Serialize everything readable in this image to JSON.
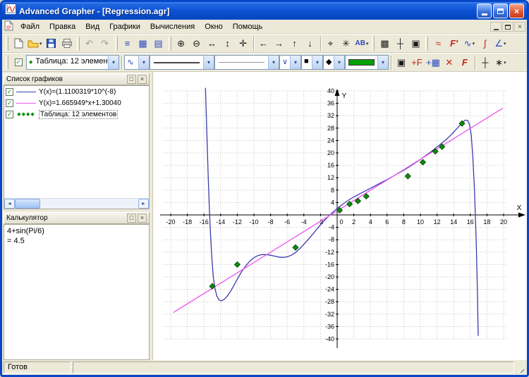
{
  "window": {
    "title": "Advanced Grapher - [Regression.agr]",
    "status_ready": "Готов"
  },
  "menu": {
    "items": [
      "Файл",
      "Правка",
      "Вид",
      "Графики",
      "Вычисления",
      "Окно",
      "Помощь"
    ]
  },
  "icons": {
    "dropdown": "▾",
    "undo": "↶",
    "redo": "↷",
    "graph_list": "≡",
    "data_table": "▦",
    "calculator": "▤",
    "zoom_in": "⊕",
    "zoom_out": "⊖",
    "zoom_x": "↔",
    "zoom_y": "↕",
    "move": "✛",
    "scroll_left": "←",
    "scroll_right": "→",
    "scroll_up": "↑",
    "scroll_down": "↓",
    "center": "⌖",
    "zoom_all": "✳",
    "labels": "AB",
    "grid": "▩",
    "axes": "┼",
    "graph_props": "▣",
    "regression": "≈",
    "derivative": "F′",
    "tangent": "∿",
    "integral": "∫",
    "angle": "∠",
    "visible_check": "✓",
    "curve_type": "∿",
    "hatch": "∨",
    "point_square": "■",
    "point_marker": "◆",
    "properties": "▣",
    "add_graph": "+F",
    "add_table": "+▦",
    "delete": "✕",
    "edit": "F",
    "options": "∗",
    "panel_box": "□",
    "panel_close": "×",
    "scrollbar_left": "◄",
    "scrollbar_right": "►"
  },
  "toolbar2": {
    "selected_object": "Таблица: 12 элементов"
  },
  "graph_list_panel": {
    "title": "Список графиков",
    "items": [
      {
        "checked": true,
        "label": "Y(x)=(1.1100319*10^(-8)",
        "color": "#3b3bb0",
        "sample": "line"
      },
      {
        "checked": true,
        "label": "Y(x)=1.665949*x+1.30040",
        "color": "#ee55ee",
        "sample": "line"
      },
      {
        "checked": true,
        "label": "Таблица: 12 элементов",
        "color": "#0a8f0a",
        "sample": "diamonds",
        "sample_glyphs": "◆◆◆◆",
        "selected": true
      }
    ]
  },
  "calculator_panel": {
    "title": "Калькулятор",
    "expression": "4+sin(Pi/6)",
    "result": "= 4.5"
  },
  "colors": {
    "titlebar_blue": "#0f54d7",
    "chrome_bg": "#ECE9D8",
    "grid_gray": "#c6c6c6",
    "curve_blue": "#3b3bb0",
    "line_magenta": "#ee55ee",
    "points_green": "#0a8f0a",
    "color_swatch_green": "#00a000"
  },
  "chart_data": {
    "type": "line",
    "title": "",
    "xlabel": "X",
    "ylabel": "Y",
    "xlim": [
      -21,
      21.5
    ],
    "ylim": [
      -42,
      42
    ],
    "x_ticks": [
      -20,
      -18,
      -16,
      -14,
      -12,
      -10,
      -8,
      -6,
      -4,
      -2,
      0,
      2,
      4,
      6,
      8,
      10,
      12,
      14,
      16,
      18,
      20
    ],
    "y_ticks": [
      -40,
      -36,
      -32,
      -28,
      -24,
      -20,
      -16,
      -12,
      -8,
      -4,
      4,
      8,
      12,
      16,
      20,
      24,
      28,
      32,
      36,
      40
    ],
    "grid": "dotted",
    "legend_position": "none",
    "series": [
      {
        "name": "Y(x)=(1.1100319*10^(-8)",
        "type": "line",
        "color": "#3b3bb0",
        "points": [
          [
            -15.82,
            41
          ],
          [
            -15.72,
            32
          ],
          [
            -15.62,
            23
          ],
          [
            -15.5,
            13
          ],
          [
            -15.38,
            4
          ],
          [
            -15.24,
            -5
          ],
          [
            -15.08,
            -13
          ],
          [
            -14.9,
            -19.5
          ],
          [
            -14.7,
            -23.5
          ],
          [
            -14.45,
            -26.2
          ],
          [
            -14.2,
            -27.4
          ],
          [
            -13.9,
            -27.7
          ],
          [
            -13.6,
            -27.3
          ],
          [
            -13.2,
            -26.2
          ],
          [
            -12.8,
            -24.6
          ],
          [
            -12.4,
            -22.7
          ],
          [
            -12,
            -20.7
          ],
          [
            -11.5,
            -18.4
          ],
          [
            -11,
            -16.5
          ],
          [
            -10.5,
            -14.9
          ],
          [
            -10,
            -13.8
          ],
          [
            -9.5,
            -13.1
          ],
          [
            -9,
            -12.8
          ],
          [
            -8.5,
            -12.8
          ],
          [
            -8,
            -13
          ],
          [
            -7.5,
            -13.3
          ],
          [
            -7,
            -13.6
          ],
          [
            -6.5,
            -13.7
          ],
          [
            -6,
            -13.5
          ],
          [
            -5.5,
            -13
          ],
          [
            -5,
            -12.1
          ],
          [
            -4.5,
            -10.9
          ],
          [
            -4,
            -9.5
          ],
          [
            -3.5,
            -8
          ],
          [
            -3,
            -6.4
          ],
          [
            -2.5,
            -4.8
          ],
          [
            -2,
            -3.2
          ],
          [
            -1.5,
            -1.7
          ],
          [
            -1,
            -0.3
          ],
          [
            -0.5,
            0.9
          ],
          [
            0,
            2.1
          ],
          [
            0.5,
            3.1
          ],
          [
            1,
            4.1
          ],
          [
            1.5,
            5
          ],
          [
            2,
            5.8
          ],
          [
            2.5,
            6.5
          ],
          [
            3,
            7.2
          ],
          [
            4,
            8.6
          ],
          [
            5,
            10
          ],
          [
            6,
            11.4
          ],
          [
            7,
            12.9
          ],
          [
            8,
            14.4
          ],
          [
            9,
            16.1
          ],
          [
            10,
            17.9
          ],
          [
            11,
            19.8
          ],
          [
            12,
            21.9
          ],
          [
            13,
            24.1
          ],
          [
            13.5,
            25.3
          ],
          [
            14,
            26.7
          ],
          [
            14.5,
            28.2
          ],
          [
            15,
            29.7
          ],
          [
            15.4,
            30.6
          ],
          [
            15.7,
            30.4
          ],
          [
            15.9,
            29.2
          ],
          [
            16.1,
            26
          ],
          [
            16.3,
            19
          ],
          [
            16.5,
            8
          ],
          [
            16.7,
            -8
          ],
          [
            16.85,
            -24
          ],
          [
            16.95,
            -39
          ]
        ]
      },
      {
        "name": "Y(x)=1.665949*x+1.30040",
        "type": "line",
        "color": "#ee55ee",
        "points": [
          [
            -19.7,
            -31.5
          ],
          [
            19.9,
            34.4
          ]
        ]
      },
      {
        "name": "Таблица: 12 элементов",
        "type": "scatter",
        "color": "#0a8f0a",
        "points": [
          [
            -15,
            -23
          ],
          [
            -12,
            -16
          ],
          [
            -5,
            -10.5
          ],
          [
            0.3,
            1.5
          ],
          [
            1.5,
            3.5
          ],
          [
            2.5,
            4.5
          ],
          [
            3.5,
            6
          ],
          [
            8.5,
            12.5
          ],
          [
            10.3,
            17
          ],
          [
            11.8,
            20.5
          ],
          [
            12.6,
            22
          ],
          [
            15,
            29.5
          ]
        ]
      }
    ]
  }
}
